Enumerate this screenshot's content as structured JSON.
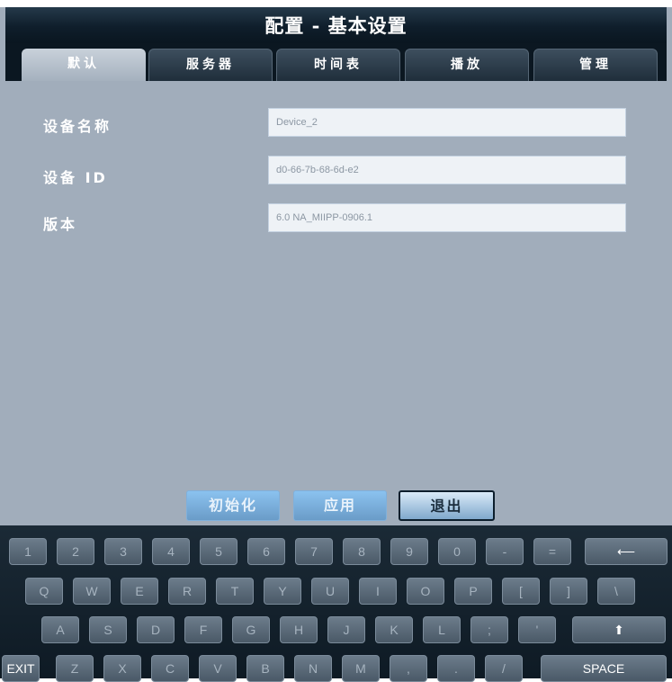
{
  "window": {
    "title": "配置 - 基本设置"
  },
  "tabs": [
    {
      "label": "默认",
      "active": true
    },
    {
      "label": "服务器",
      "active": false
    },
    {
      "label": "时间表",
      "active": false
    },
    {
      "label": "播放",
      "active": false
    },
    {
      "label": "管理",
      "active": false
    }
  ],
  "form": {
    "device_name": {
      "label": "设备名称",
      "value": "Device_2"
    },
    "device_id": {
      "label": "设备 ID",
      "value": "d0-66-7b-68-6d-e2"
    },
    "version": {
      "label": "版本",
      "value": "6.0 NA_MIIPP-0906.1"
    }
  },
  "actions": {
    "init": "初始化",
    "apply": "应用",
    "exit": "退出"
  },
  "keyboard": {
    "row1": [
      "1",
      "2",
      "3",
      "4",
      "5",
      "6",
      "7",
      "8",
      "9",
      "0",
      "-",
      "="
    ],
    "row2": [
      "Q",
      "W",
      "E",
      "R",
      "T",
      "Y",
      "U",
      "I",
      "O",
      "P",
      "[",
      "]",
      "\\"
    ],
    "row3": [
      "A",
      "S",
      "D",
      "F",
      "G",
      "H",
      "J",
      "K",
      "L",
      ";",
      "'"
    ],
    "row4": [
      "Z",
      "X",
      "C",
      "V",
      "B",
      "N",
      "M",
      ",",
      ".",
      "/"
    ],
    "backspace": "⟵",
    "shift": "⬆",
    "exit": "EXIT",
    "space": "SPACE"
  },
  "colors": {
    "panel": "#a1adbb",
    "title_bar": "#0f1e2b",
    "accent_blue": "#7fb0dc"
  }
}
